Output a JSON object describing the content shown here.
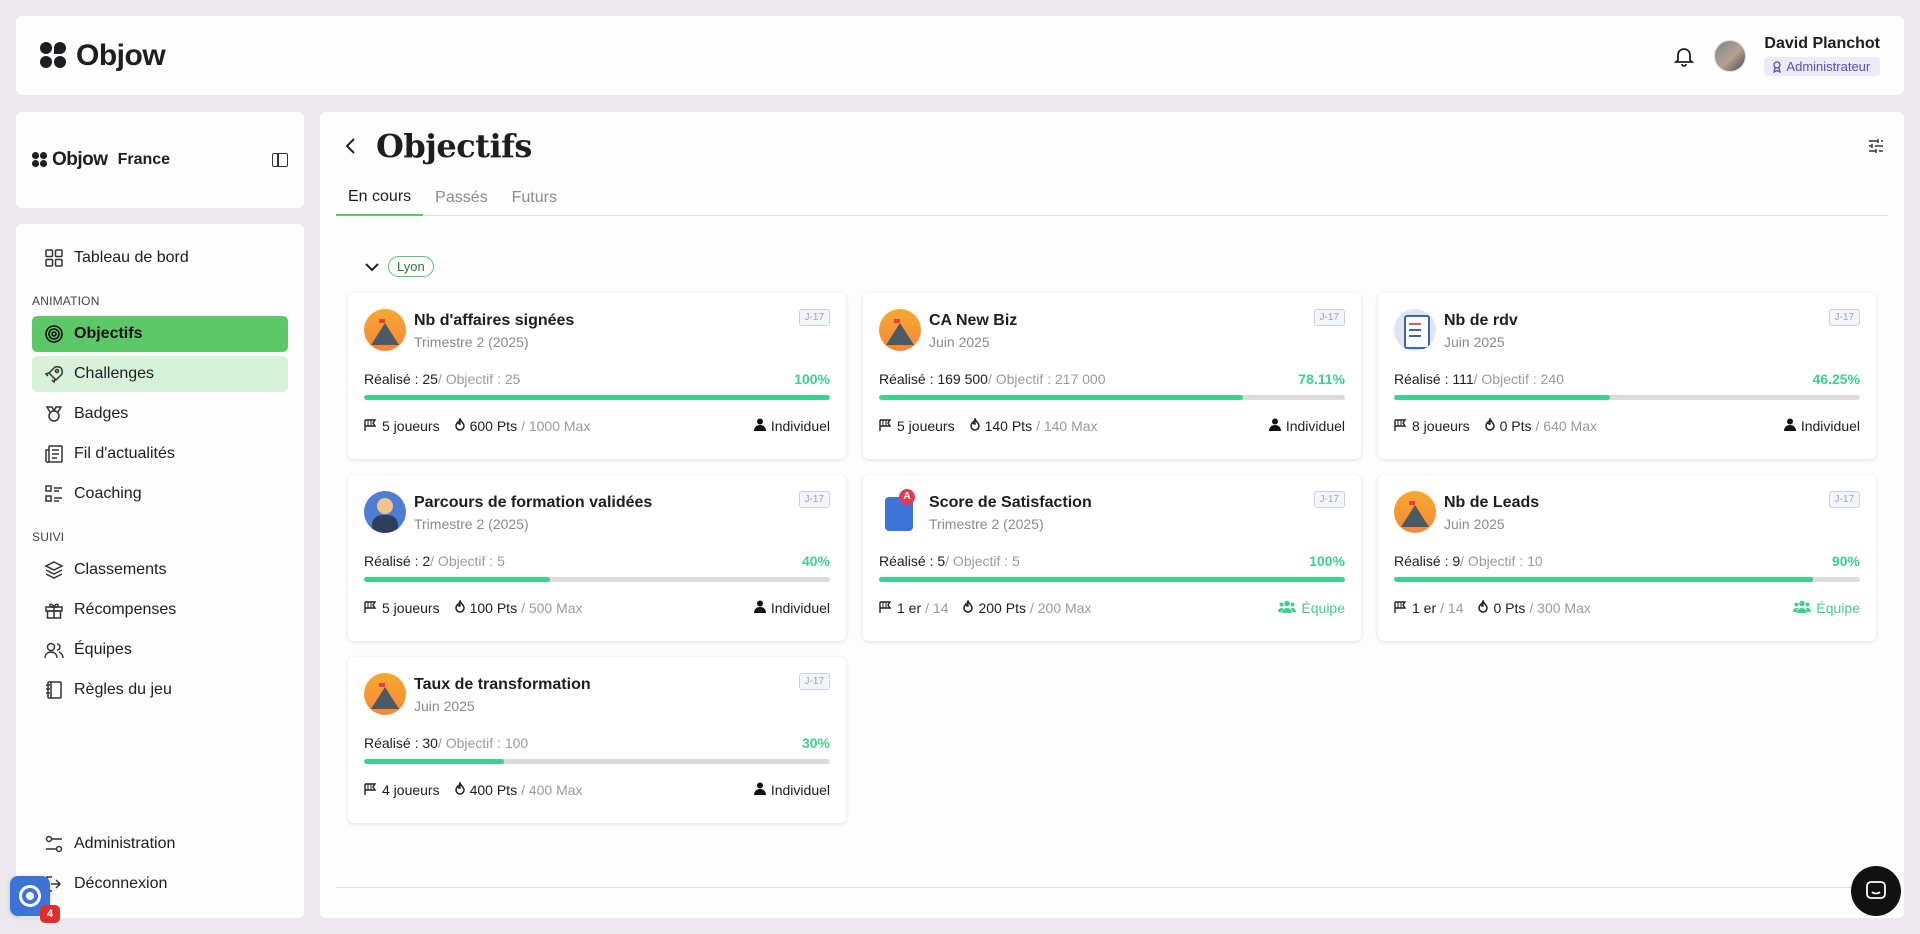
{
  "app": {
    "name": "Objow"
  },
  "topbar": {
    "user_name": "David Planchot",
    "user_role": "Administrateur"
  },
  "sidebar": {
    "brand": "Objow",
    "country": "France",
    "dashboard": "Tableau de bord",
    "section_animation": "ANIMATION",
    "section_suivi": "SUIVI",
    "items": [
      "Objectifs",
      "Challenges",
      "Badges",
      "Fil d'actualités",
      "Coaching",
      "Classements",
      "Récompenses",
      "Équipes",
      "Règles du jeu",
      "Administration",
      "Déconnexion"
    ]
  },
  "main": {
    "title": "Objectifs",
    "tabs": [
      "En cours",
      "Passés",
      "Futurs"
    ],
    "group": "Lyon",
    "cards": [
      {
        "title": "Nb d'affaires signées",
        "period": "Trimestre 2 (2025)",
        "tag": "J-17",
        "realise_label": "Réalisé : 25",
        "objectif_label": " / Objectif : 25",
        "pct": "100%",
        "progress": 100,
        "players": "5 joueurs",
        "pts": "600 Pts",
        "max": " / 1000 Max",
        "mode": "Individuel"
      },
      {
        "title": "CA New Biz",
        "period": "Juin 2025",
        "tag": "J-17",
        "realise_label": "Réalisé : 169 500",
        "objectif_label": " / Objectif : 217 000",
        "pct": "78.11%",
        "progress": 78.11,
        "players": "5 joueurs",
        "pts": "140 Pts",
        "max": " / 140 Max",
        "mode": "Individuel"
      },
      {
        "title": "Nb de rdv",
        "period": "Juin 2025",
        "tag": "J-17",
        "realise_label": "Réalisé : 111",
        "objectif_label": " / Objectif : 240",
        "pct": "46.25%",
        "progress": 46.25,
        "players": "8 joueurs",
        "pts": "0 Pts",
        "max": " / 640 Max",
        "mode": "Individuel"
      },
      {
        "title": "Parcours de formation validées",
        "period": "Trimestre 2 (2025)",
        "tag": "J-17",
        "realise_label": "Réalisé : 2",
        "objectif_label": " / Objectif : 5",
        "pct": "40%",
        "progress": 40,
        "players": "5 joueurs",
        "pts": "100 Pts",
        "max": " / 500 Max",
        "mode": "Individuel"
      },
      {
        "title": "Score de Satisfaction",
        "period": "Trimestre 2 (2025)",
        "tag": "J-17",
        "realise_label": "Réalisé : 5",
        "objectif_label": " / Objectif : 5",
        "pct": "100%",
        "progress": 100,
        "players": "1 er",
        "players_suffix": " / 14",
        "pts": "200 Pts",
        "max": " / 200 Max",
        "mode": "Équipe"
      },
      {
        "title": "Nb de Leads",
        "period": "Juin 2025",
        "tag": "J-17",
        "realise_label": "Réalisé : 9",
        "objectif_label": " / Objectif : 10",
        "pct": "90%",
        "progress": 90,
        "players": "1 er",
        "players_suffix": " / 14",
        "pts": "0 Pts",
        "max": " / 300 Max",
        "mode": "Équipe"
      },
      {
        "title": "Taux de transformation",
        "period": "Juin 2025",
        "tag": "J-17",
        "realise_label": "Réalisé : 30",
        "objectif_label": " / Objectif : 100",
        "pct": "30%",
        "progress": 30,
        "players": "4 joueurs",
        "pts": "400 Pts",
        "max": " / 400 Max",
        "mode": "Individuel"
      }
    ]
  },
  "widgets": {
    "notification_count": "4"
  },
  "colors": {
    "accent": "#5cc867",
    "progress": "#3fcf8e",
    "role": "#5b4fb9"
  }
}
